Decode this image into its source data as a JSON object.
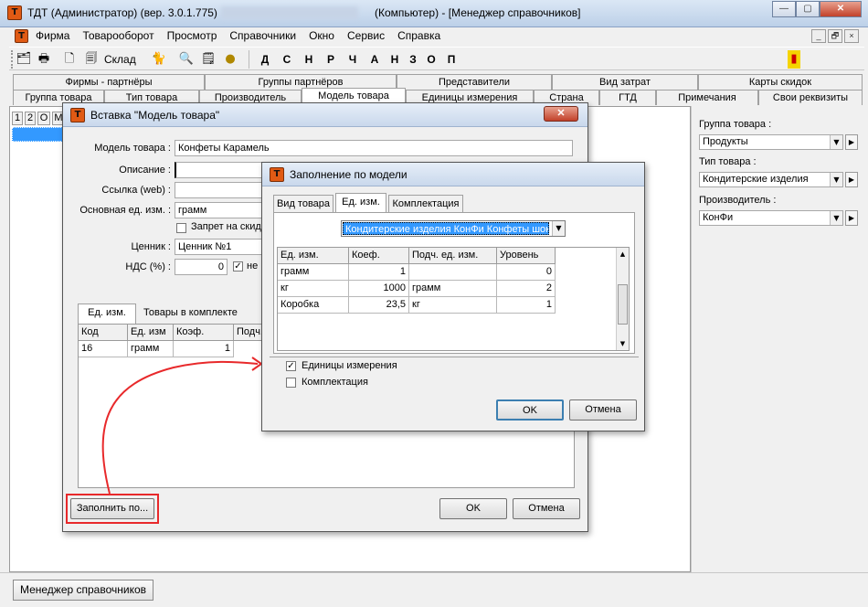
{
  "app": {
    "title": "ТДТ  (Администратор) (вер. 3.0.1.775)",
    "title_context": "(Компьютер) - [Менеджер справочников]",
    "icon_letter": "Т",
    "caption_buttons": [
      "—",
      "▢",
      "✕"
    ],
    "mdi_buttons": [
      "_",
      "🗗",
      "×"
    ]
  },
  "menu": [
    "Фирма",
    "Товарооборот",
    "Просмотр",
    "Справочники",
    "Окно",
    "Сервис",
    "Справка"
  ],
  "toolbar": {
    "sklad_label": "Склад",
    "icons": [
      "printer-icon",
      "document-icon",
      "copy-icon",
      "cat-icon",
      "search-icon",
      "list-icon",
      "coin-icon"
    ],
    "letters": [
      "Д",
      "С",
      "Н",
      "Р",
      "Ч",
      "А",
      "Н",
      "З",
      "О",
      "П"
    ],
    "exit_icon": "exit-icon"
  },
  "tabs_top": [
    "Фирмы - партнёры",
    "Группы партнёров",
    "Представители",
    "Вид затрат",
    "Карты скидок"
  ],
  "tabs_bottom": [
    "Группа товара",
    "Тип товара",
    "Производитель",
    "Модель товара",
    "Единицы измерения",
    "Страна",
    "ГТД",
    "Примечания",
    "Свои реквизиты"
  ],
  "grid_headers": [
    "1",
    "2",
    "О",
    "М"
  ],
  "right_panel": {
    "group_label": "Группа товара :",
    "group_value": "Продукты",
    "type_label": "Тип товара :",
    "type_value": "Кондитерские изделия",
    "maker_label": "Производитель :",
    "maker_value": "КонФи"
  },
  "insert_dialog": {
    "title": "Вставка \"Модель товара\"",
    "fields": [
      {
        "label": "Модель товара :",
        "value": "Конфеты Карамель"
      },
      {
        "label": "Описание :",
        "value": ""
      },
      {
        "label": "Ссылка (web) :",
        "value": ""
      },
      {
        "label": "Основная ед. изм. :",
        "value": "грамм"
      }
    ],
    "zapret_label": "Запрет на скид",
    "price_label": "Ценник :",
    "price_value": "Ценник №1",
    "nds_label": "НДС (%) :",
    "nds_value": "0",
    "nds_check_label": "не",
    "tabs": [
      "Ед. изм.",
      "Товары в комплекте"
    ],
    "grid_headers": [
      "Код",
      "Ед. изм",
      "Коэф.",
      "Подч."
    ],
    "grid_rows": [
      [
        "16",
        "грамм",
        "1",
        ""
      ]
    ],
    "fill_button": "Заполнить по...",
    "ok": "OK",
    "cancel": "Отмена"
  },
  "fill_dialog": {
    "title": "Заполнение по модели",
    "tabs": [
      "Вид товара",
      "Ед. изм.",
      "Комплектация"
    ],
    "model_select": "Кондитерские изделия КонФи Конфеты шок",
    "headers": [
      "Ед. изм.",
      "Коеф.",
      "Подч. ед. изм.",
      "Уровень"
    ],
    "rows": [
      [
        "грамм",
        "1",
        "",
        "0"
      ],
      [
        "кг",
        "1000",
        "грамм",
        "2"
      ],
      [
        "Коробка",
        "23,5",
        "кг",
        "1"
      ]
    ],
    "check_units": "Единицы измерения",
    "check_kit": "Комплектация",
    "ok": "OK",
    "cancel": "Отмена"
  },
  "status": {
    "taskbar_item": "Менеджер справочников"
  },
  "colors": {
    "annotation": "#e8292b",
    "selection": "#3399ff",
    "icon_orange": "#e05a14"
  }
}
